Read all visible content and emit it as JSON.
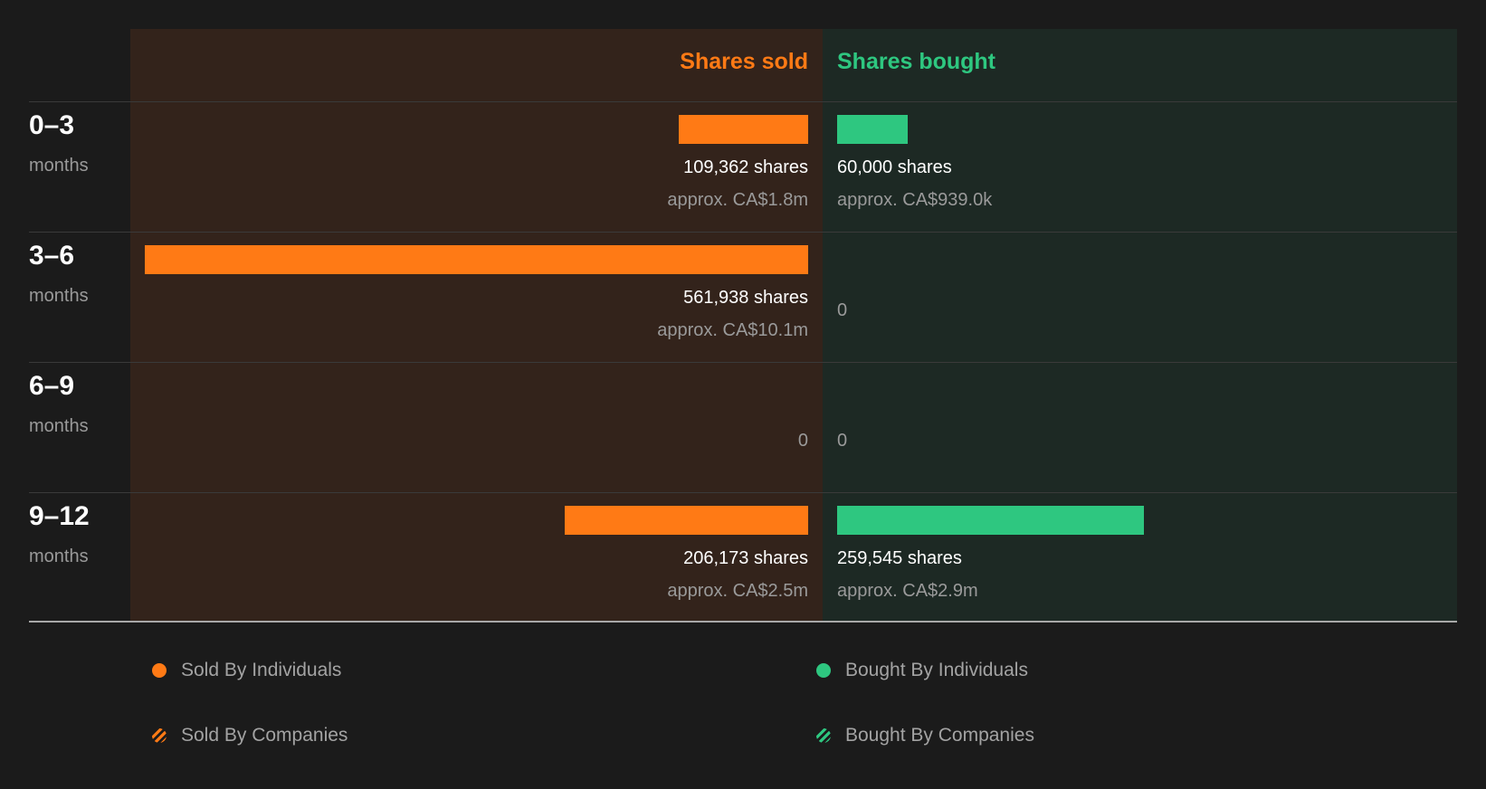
{
  "colors": {
    "sold": "#ff7a15",
    "bought": "#2ec780",
    "sold_panel": "#33231b",
    "bought_panel": "#1d2924"
  },
  "chart_data": {
    "type": "bar",
    "orientation": "horizontal-diverging",
    "headers": {
      "sold": "Shares sold",
      "bought": "Shares bought"
    },
    "categories": [
      {
        "period": "0–3",
        "unit": "months"
      },
      {
        "period": "3–6",
        "unit": "months"
      },
      {
        "period": "6–9",
        "unit": "months"
      },
      {
        "period": "9–12",
        "unit": "months"
      }
    ],
    "series": [
      {
        "name": "Shares sold",
        "values": [
          109362,
          561938,
          0,
          206173
        ],
        "labels": [
          "109,362 shares",
          "561,938 shares",
          "0",
          "206,173 shares"
        ],
        "approx": [
          "approx. CA$1.8m",
          "approx. CA$10.1m",
          "",
          "approx. CA$2.5m"
        ]
      },
      {
        "name": "Shares bought",
        "values": [
          60000,
          0,
          0,
          259545
        ],
        "labels": [
          "60,000 shares",
          "0",
          "0",
          "259,545 shares"
        ],
        "approx": [
          "approx. CA$939.0k",
          "",
          "",
          "approx. CA$2.9m"
        ]
      }
    ],
    "legend": [
      {
        "label": "Sold By Individuals",
        "kind": "dot",
        "color": "#ff7a15"
      },
      {
        "label": "Bought By Individuals",
        "kind": "dot",
        "color": "#2ec780"
      },
      {
        "label": "Sold By Companies",
        "kind": "hatch",
        "color": "#ff7a15"
      },
      {
        "label": "Bought By Companies",
        "kind": "hatch",
        "color": "#2ec780"
      }
    ]
  }
}
